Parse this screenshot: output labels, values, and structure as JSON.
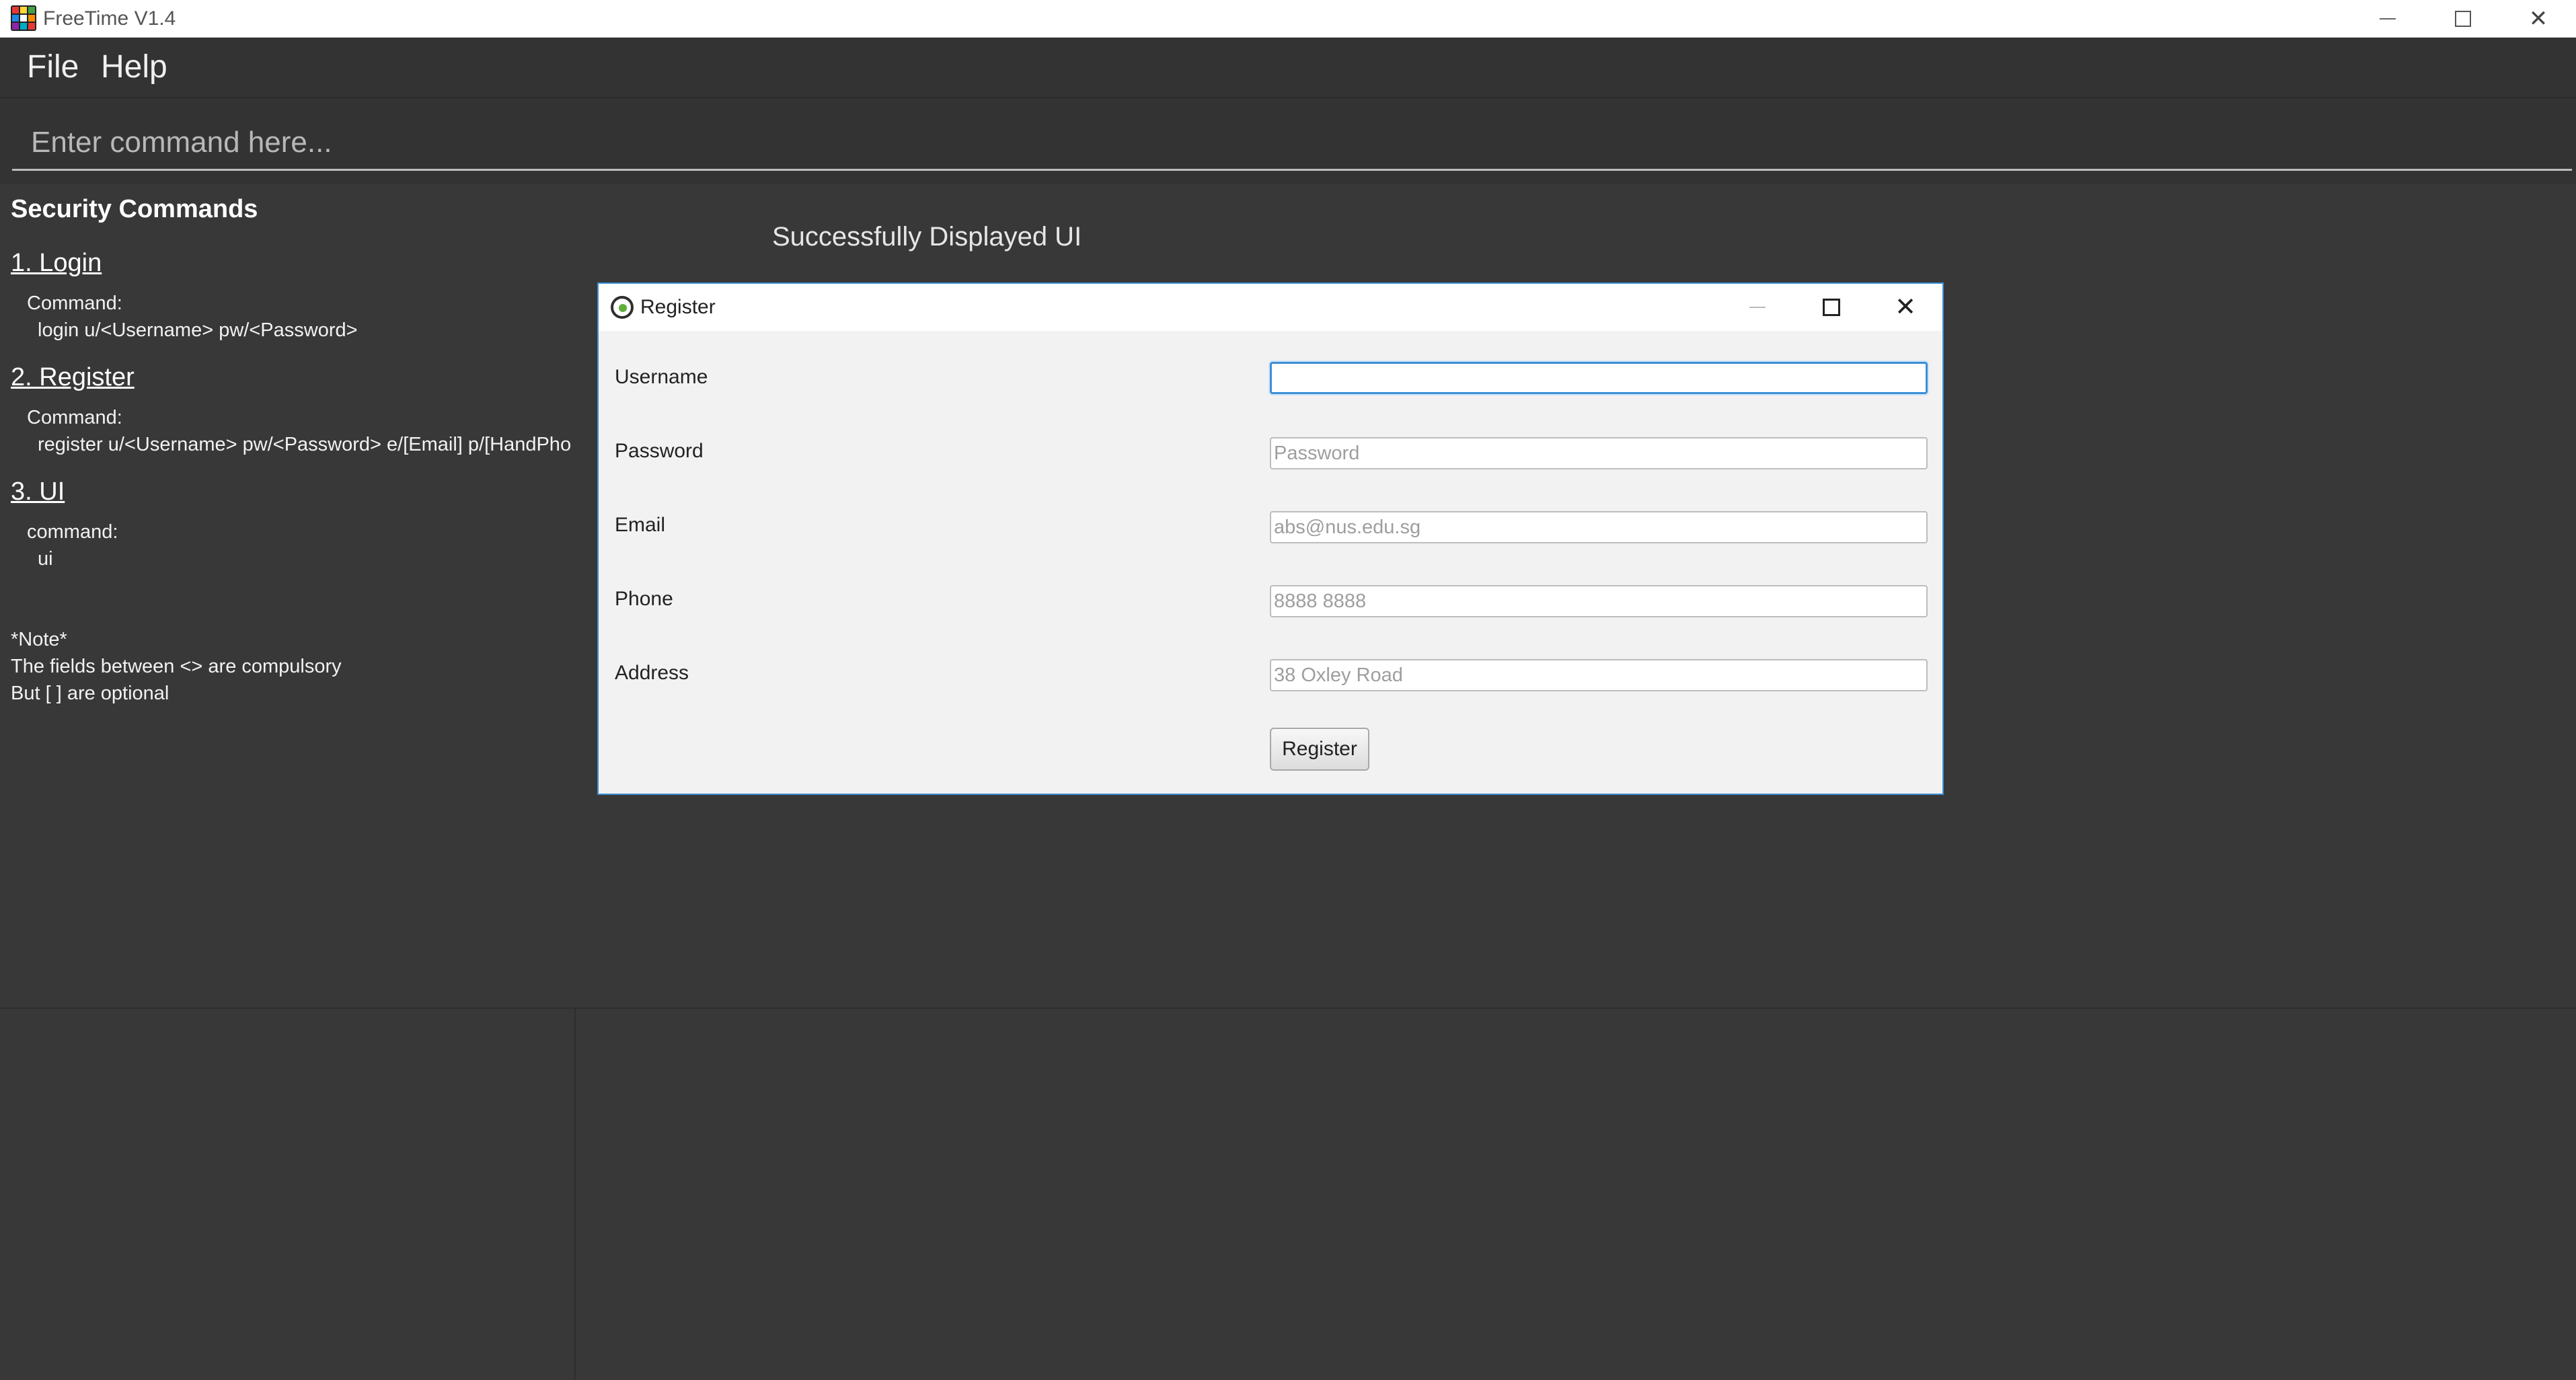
{
  "window": {
    "title": "FreeTime V1.4",
    "icon": "app-grid-icon",
    "controls": {
      "minimize_icon": "minimize-icon",
      "maximize_icon": "maximize-icon",
      "close_icon": "close-icon",
      "close_glyph": "✕"
    }
  },
  "menu": {
    "file": "File",
    "help": "Help"
  },
  "command": {
    "placeholder": "Enter command here..."
  },
  "help_panel": {
    "title": "Security Commands",
    "sections": [
      {
        "heading": "1. Login",
        "lines": [
          "Command:",
          "login u/<Username> pw/<Password>"
        ]
      },
      {
        "heading": "2. Register",
        "lines": [
          "Command:",
          "register u/<Username> pw/<Password> e/[Email] p/[HandPho"
        ]
      },
      {
        "heading": "3. UI",
        "lines": [
          "command:",
          "ui"
        ]
      }
    ],
    "note": [
      "*Note*",
      "The fields between <> are compulsory",
      "But [ ] are optional"
    ]
  },
  "result": {
    "text": "Successfully Displayed UI"
  },
  "dialog": {
    "title": "Register",
    "icon": "key-icon",
    "close_glyph": "✕",
    "fields": [
      {
        "label": "Username",
        "value": "",
        "placeholder": ""
      },
      {
        "label": "Password",
        "value": "",
        "placeholder": "Password"
      },
      {
        "label": "Email",
        "value": "",
        "placeholder": "abs@nus.edu.sg"
      },
      {
        "label": "Phone",
        "value": "",
        "placeholder": "8888 8888"
      },
      {
        "label": "Address",
        "value": "",
        "placeholder": "38 Oxley Road"
      }
    ],
    "submit_label": "Register"
  },
  "colors": {
    "background": "#383838",
    "menubar": "#333333",
    "accent": "#3c8fd6",
    "dialog_bg": "#f2f2f2"
  }
}
